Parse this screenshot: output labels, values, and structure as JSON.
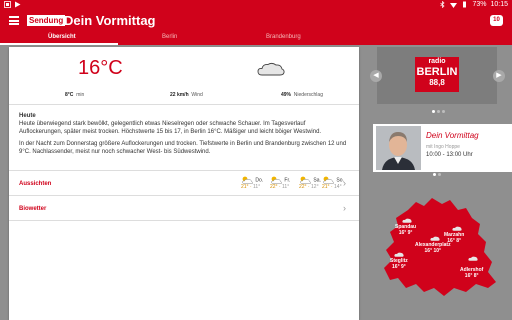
{
  "statusbar": {
    "battery": "73%",
    "time": "10:15"
  },
  "appbar": {
    "badge": "Sendung",
    "title": "Dein Vormittag",
    "notification_count": "10"
  },
  "tabs": [
    {
      "label": "Übersicht",
      "active": true
    },
    {
      "label": "Berlin",
      "active": false
    },
    {
      "label": "Brandenburg",
      "active": false
    }
  ],
  "weather": {
    "temperature": "16°C",
    "condition_icon": "cloud-icon",
    "min": {
      "value": "8°C",
      "label": "min"
    },
    "wind": {
      "value": "22 km/h",
      "label": "Wind"
    },
    "rain": {
      "value": "49%",
      "label": "Niederschlag"
    }
  },
  "description": {
    "heading": "Heute",
    "para1": "Heute überwiegend stark bewölkt, gelegentlich etwas Nieselregen oder schwache Schauer. Im Tagesverlauf Auflockerungen, später meist trocken. Höchstwerte 15 bis 17, in Berlin 16°C. Mäßiger und leicht böiger Westwind.",
    "para2": "In der Nacht zum Donnerstag größere Auflockerungen und trocken. Tiefstwerte in Berlin und Brandenburg zwischen 12 und 9°C. Nachlassender, meist nur noch schwacher West- bis Südwestwind."
  },
  "forecast": {
    "label": "Aussichten",
    "days": [
      {
        "day": "Do.",
        "hi": "21°",
        "lo": "11°"
      },
      {
        "day": "Fr.",
        "hi": "22°",
        "lo": "11°"
      },
      {
        "day": "Sa.",
        "hi": "22°",
        "lo": "12°"
      },
      {
        "day": "So.",
        "hi": "21°",
        "lo": "14°"
      }
    ]
  },
  "biowetter": {
    "label": "Biowetter"
  },
  "station": {
    "logo_line1": "radio",
    "logo_line2": "BERLIN",
    "logo_line3": "88,8",
    "show_title": "Dein Vormittag",
    "show_host": "mit Ingo Hoppe",
    "show_time": "10:00 - 13:00 Uhr"
  },
  "map": {
    "places": [
      {
        "name": "Spandau",
        "temps": "16° 9°"
      },
      {
        "name": "Marzahn",
        "temps": "16° 8°"
      },
      {
        "name": "Alexanderplatz",
        "temps": "16° 10°"
      },
      {
        "name": "Steglitz",
        "temps": "16° 9°"
      },
      {
        "name": "Adlershof",
        "temps": "16° 8°"
      }
    ]
  },
  "colors": {
    "accent": "#d0021b",
    "background": "#8f8f8f"
  }
}
